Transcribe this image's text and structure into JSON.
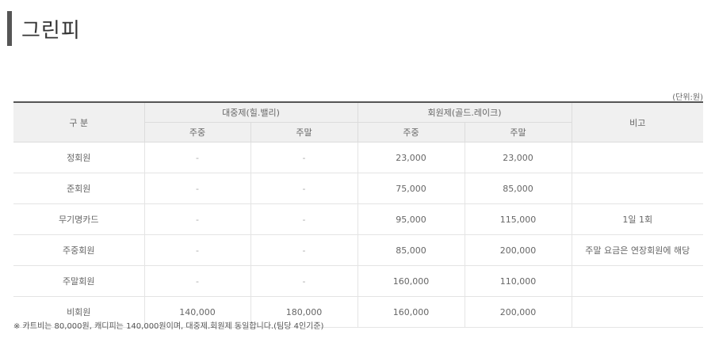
{
  "title": "그린피",
  "unit": "(단위:원)",
  "table": {
    "col_category": "구 분",
    "group_a": "대중제(힐.밸리)",
    "group_b": "회원제(골드.레이크)",
    "col_remark": "비고",
    "sub_weekday_a": "주중",
    "sub_weekend_a": "주말",
    "sub_weekday_b": "주중",
    "sub_weekend_b": "주말",
    "rows": [
      {
        "name": "정회원",
        "a_weekday": "-",
        "a_weekend": "-",
        "b_weekday": "23,000",
        "b_weekend": "23,000",
        "remark": ""
      },
      {
        "name": "준회원",
        "a_weekday": "-",
        "a_weekend": "-",
        "b_weekday": "75,000",
        "b_weekend": "85,000",
        "remark": ""
      },
      {
        "name": "무기명카드",
        "a_weekday": "-",
        "a_weekend": "-",
        "b_weekday": "95,000",
        "b_weekend": "115,000",
        "remark": "1일 1회"
      },
      {
        "name": "주중회원",
        "a_weekday": "-",
        "a_weekend": "-",
        "b_weekday": "85,000",
        "b_weekend": "200,000",
        "remark": "주말 요금은 연장회원에 해당"
      },
      {
        "name": "주말회원",
        "a_weekday": "-",
        "a_weekend": "-",
        "b_weekday": "160,000",
        "b_weekend": "110,000",
        "remark": ""
      },
      {
        "name": "비회원",
        "a_weekday": "140,000",
        "a_weekend": "180,000",
        "b_weekday": "160,000",
        "b_weekend": "200,000",
        "remark": ""
      }
    ]
  },
  "note": "※ 카트비는 80,000원, 캐디피는 140,000원이며, 대중제.회원제 동일합니다.(팀당 4인기준)"
}
